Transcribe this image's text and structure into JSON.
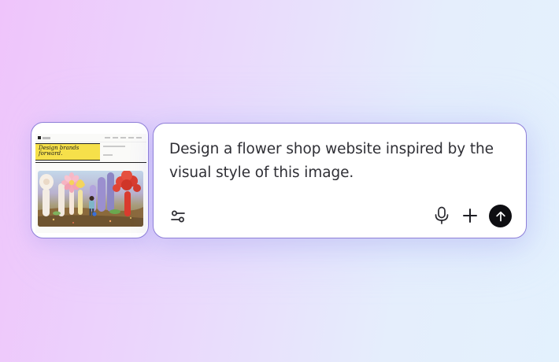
{
  "attachment": {
    "preview": {
      "headline": "Design brands forward."
    }
  },
  "composer": {
    "prompt_text": "Design a flower shop website inspired by the visual style of this image.",
    "icons": {
      "settings": "sliders-icon",
      "mic": "microphone-icon",
      "add": "plus-icon",
      "send": "arrow-up-icon"
    },
    "colors": {
      "card_border": "#8e7fd8",
      "send_button": "#0e0e12",
      "text": "#2f2f35"
    }
  }
}
